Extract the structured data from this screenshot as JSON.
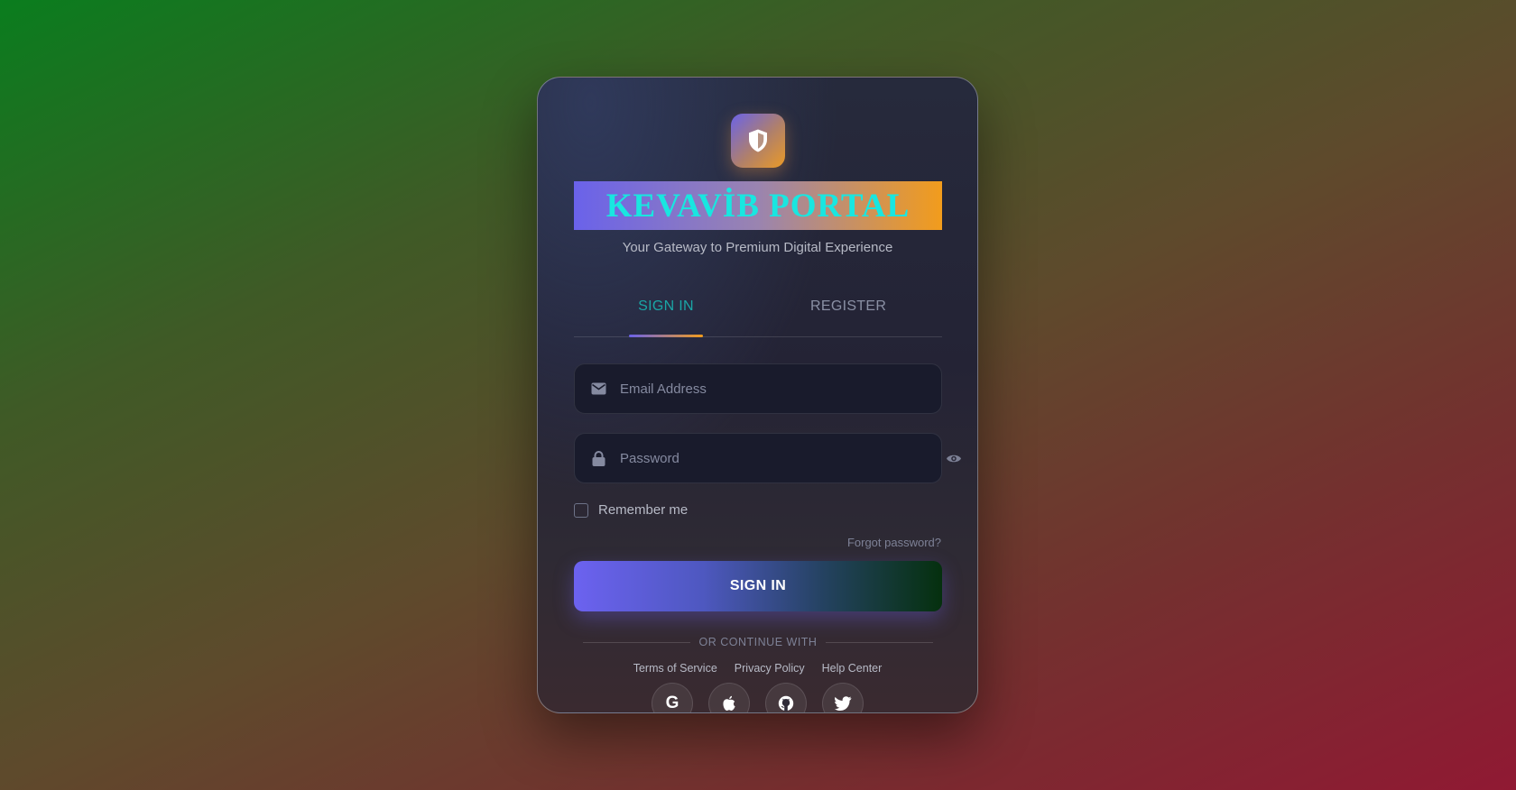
{
  "brand": {
    "title": "KEVAVİB PORTAL",
    "subtitle": "Your Gateway to Premium Digital Experience",
    "logo_icon": "shield-icon"
  },
  "tabs": [
    {
      "label": "SIGN IN",
      "active": true
    },
    {
      "label": "REGISTER",
      "active": false
    }
  ],
  "form": {
    "email": {
      "placeholder": "Email Address",
      "value": "",
      "icon": "envelope-icon"
    },
    "password": {
      "placeholder": "Password",
      "value": "",
      "icon": "lock-icon",
      "toggle_icon": "eye-icon"
    },
    "remember_label": "Remember me",
    "remember_checked": false,
    "forgot_label": "Forgot password?",
    "submit_label": "SIGN IN"
  },
  "divider_label": "OR CONTINUE WITH",
  "footer_links": [
    "Terms of Service",
    "Privacy Policy",
    "Help Center"
  ],
  "social": [
    {
      "name": "google",
      "glyph": "G",
      "icon": "google-icon"
    },
    {
      "name": "apple",
      "icon": "apple-icon"
    },
    {
      "name": "github",
      "icon": "github-icon"
    },
    {
      "name": "twitter",
      "icon": "twitter-icon"
    }
  ],
  "colors": {
    "accent_start": "#6a62ea",
    "accent_end": "#f29c1c",
    "title_text": "#19e6e0",
    "active_tab": "#1aa6a6"
  }
}
